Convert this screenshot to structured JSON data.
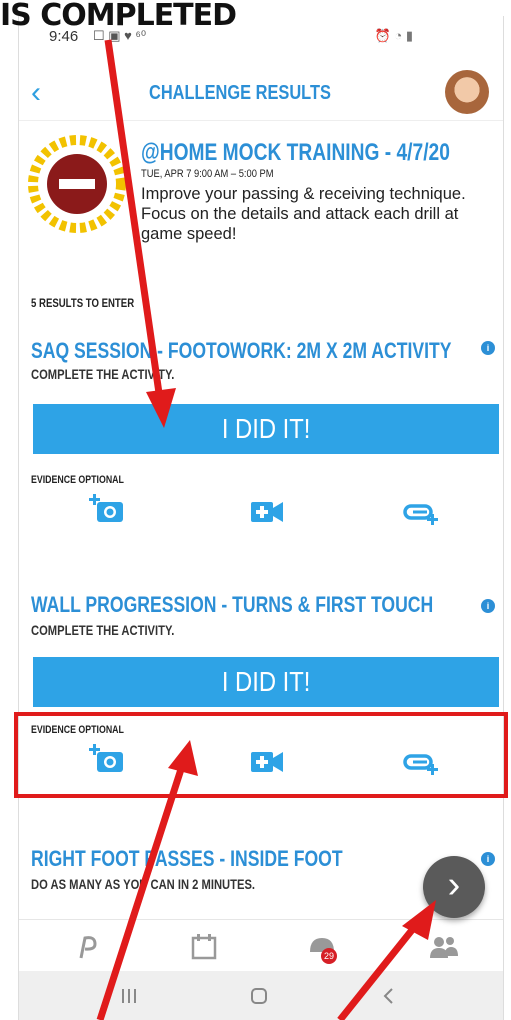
{
  "annotation": {
    "banner_text": "IS COMPLETED",
    "highlight_color": "#e01b1b"
  },
  "statusbar": {
    "time": "9:46",
    "left_icons": "☐ ▣ ♥ ⁶⁰",
    "right_icons": "⏰ ◔ ▮"
  },
  "header": {
    "title": "CHALLENGE RESULTS",
    "back_icon": "chevron-left-icon",
    "accent_color": "#2c8fd6"
  },
  "challenge": {
    "title": "@HOME MOCK TRAINING - 4/7/20",
    "date": "TUE, APR 7 9:00 AM – 5:00 PM",
    "description": "Improve your passing & receiving technique. Focus on the details and attack each drill at game speed!",
    "results_to_enter": "5 RESULTS TO ENTER"
  },
  "activities": [
    {
      "title": "SAQ SESSION - FOOTOWORK: 2M X 2M ACTIVITY",
      "subtitle": "COMPLETE THE ACTIVITY.",
      "button_label": "I DID IT!",
      "evidence_label": "EVIDENCE OPTIONAL"
    },
    {
      "title": "WALL PROGRESSION - TURNS & FIRST TOUCH",
      "subtitle": "COMPLETE THE ACTIVITY.",
      "button_label": "I DID IT!",
      "evidence_label": "EVIDENCE OPTIONAL"
    },
    {
      "title": "RIGHT FOOT PASSES - INSIDE FOOT",
      "subtitle": "DO AS MANY AS YOU CAN IN 2 MINUTES."
    }
  ],
  "bottom_nav": {
    "badge_count": "29",
    "items": [
      "logo-icon",
      "calendar-icon",
      "helmet-icon",
      "team-icon"
    ]
  },
  "fab_icon": "chevron-right-icon"
}
